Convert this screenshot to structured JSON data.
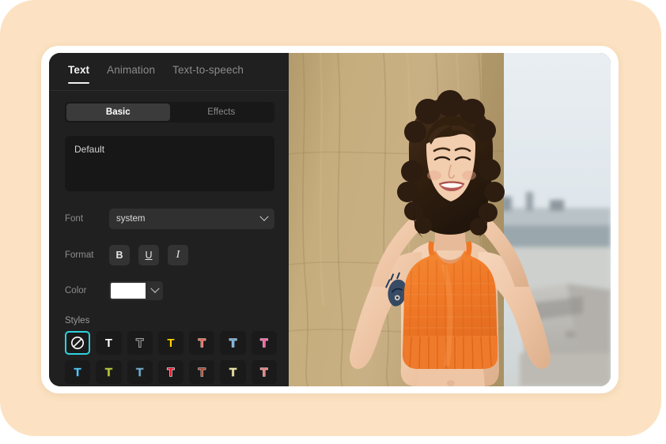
{
  "window": {
    "tabs": [
      {
        "label": "Text",
        "active": true
      },
      {
        "label": "Animation",
        "active": false
      },
      {
        "label": "Text-to-speech",
        "active": false
      }
    ],
    "segmented": [
      {
        "label": "Basic",
        "active": true
      },
      {
        "label": "Effects",
        "active": false
      }
    ]
  },
  "editor": {
    "text_value": "Default",
    "text_placeholder": "Default",
    "font": {
      "label": "Font",
      "value": "system",
      "caret_icon": "chevron-down-icon"
    },
    "format": {
      "label": "Format",
      "buttons": [
        {
          "name": "bold",
          "glyph": "B"
        },
        {
          "name": "underline",
          "glyph": "U"
        },
        {
          "name": "italic",
          "glyph": "I"
        }
      ]
    },
    "color": {
      "label": "Color",
      "value": "#ffffff",
      "caret_icon": "chevron-down-icon"
    },
    "styles": {
      "label": "Styles",
      "selection_color": "#2ed3e0",
      "items": [
        {
          "name": "style-none",
          "icon": "no-style-icon",
          "glyph": "",
          "fill": "",
          "stroke": "",
          "selected": true
        },
        {
          "name": "style-white",
          "icon": "text-style-icon",
          "glyph": "T",
          "fill": "#ffffff",
          "stroke": "",
          "selected": false
        },
        {
          "name": "style-outline",
          "icon": "text-style-icon",
          "glyph": "T",
          "fill": "#2a2a2a",
          "stroke": "#e8e8e8",
          "selected": false
        },
        {
          "name": "style-yellow",
          "icon": "text-style-icon",
          "glyph": "T",
          "fill": "#ffd400",
          "stroke": "",
          "selected": false
        },
        {
          "name": "style-salmon",
          "icon": "text-style-icon",
          "glyph": "T",
          "fill": "#e8604f",
          "stroke": "#f7d2c8",
          "selected": false
        },
        {
          "name": "style-skyblue",
          "icon": "text-style-icon",
          "glyph": "T",
          "fill": "#6aa9d6",
          "stroke": "#cfe4f3",
          "selected": false
        },
        {
          "name": "style-pink",
          "icon": "text-style-icon",
          "glyph": "T",
          "fill": "#f25f9e",
          "stroke": "#ffd3e6",
          "selected": false
        },
        {
          "name": "style-cyan",
          "icon": "text-style-icon",
          "glyph": "T",
          "fill": "#58c6f0",
          "stroke": "#1b4a63",
          "selected": false
        },
        {
          "name": "style-olive",
          "icon": "text-style-icon",
          "glyph": "T",
          "fill": "#bcc93f",
          "stroke": "#5c6320",
          "selected": false
        },
        {
          "name": "style-steelblue",
          "icon": "text-style-icon",
          "glyph": "T",
          "fill": "#79a8c4",
          "stroke": "#32566b",
          "selected": false
        },
        {
          "name": "style-red",
          "icon": "text-style-icon",
          "glyph": "T",
          "fill": "#e8122e",
          "stroke": "#ffffff",
          "selected": false
        },
        {
          "name": "style-rust",
          "icon": "text-style-icon",
          "glyph": "T",
          "fill": "#a8402c",
          "stroke": "#e6d6cc",
          "selected": false
        },
        {
          "name": "style-cream",
          "icon": "text-style-icon",
          "glyph": "T",
          "fill": "#efeab0",
          "stroke": "#8c8a5c",
          "selected": false
        },
        {
          "name": "style-rose",
          "icon": "text-style-icon",
          "glyph": "T",
          "fill": "#e47f80",
          "stroke": "#f3cfcf",
          "selected": false
        }
      ]
    }
  },
  "preview": {
    "alt": "Smiling woman with curly dark hair wearing an orange ribbed crop top, arms raised overhead forming a circle, standing in front of a tan draped wall outdoors",
    "colors": {
      "wall": "#c2a97a",
      "wall_shadow": "#a88d5e",
      "sky": "#dfe6ec",
      "skin": "#f0c9ae",
      "hair": "#3a2418",
      "top": "#f07a2a",
      "concrete": "#b9b7b2",
      "tattoo": "#1e3a5f"
    }
  },
  "theme": {
    "page_background": "#fce2c2",
    "frame": "#ffffff",
    "panel_background": "#202020",
    "accent": "#2ed3e0"
  }
}
